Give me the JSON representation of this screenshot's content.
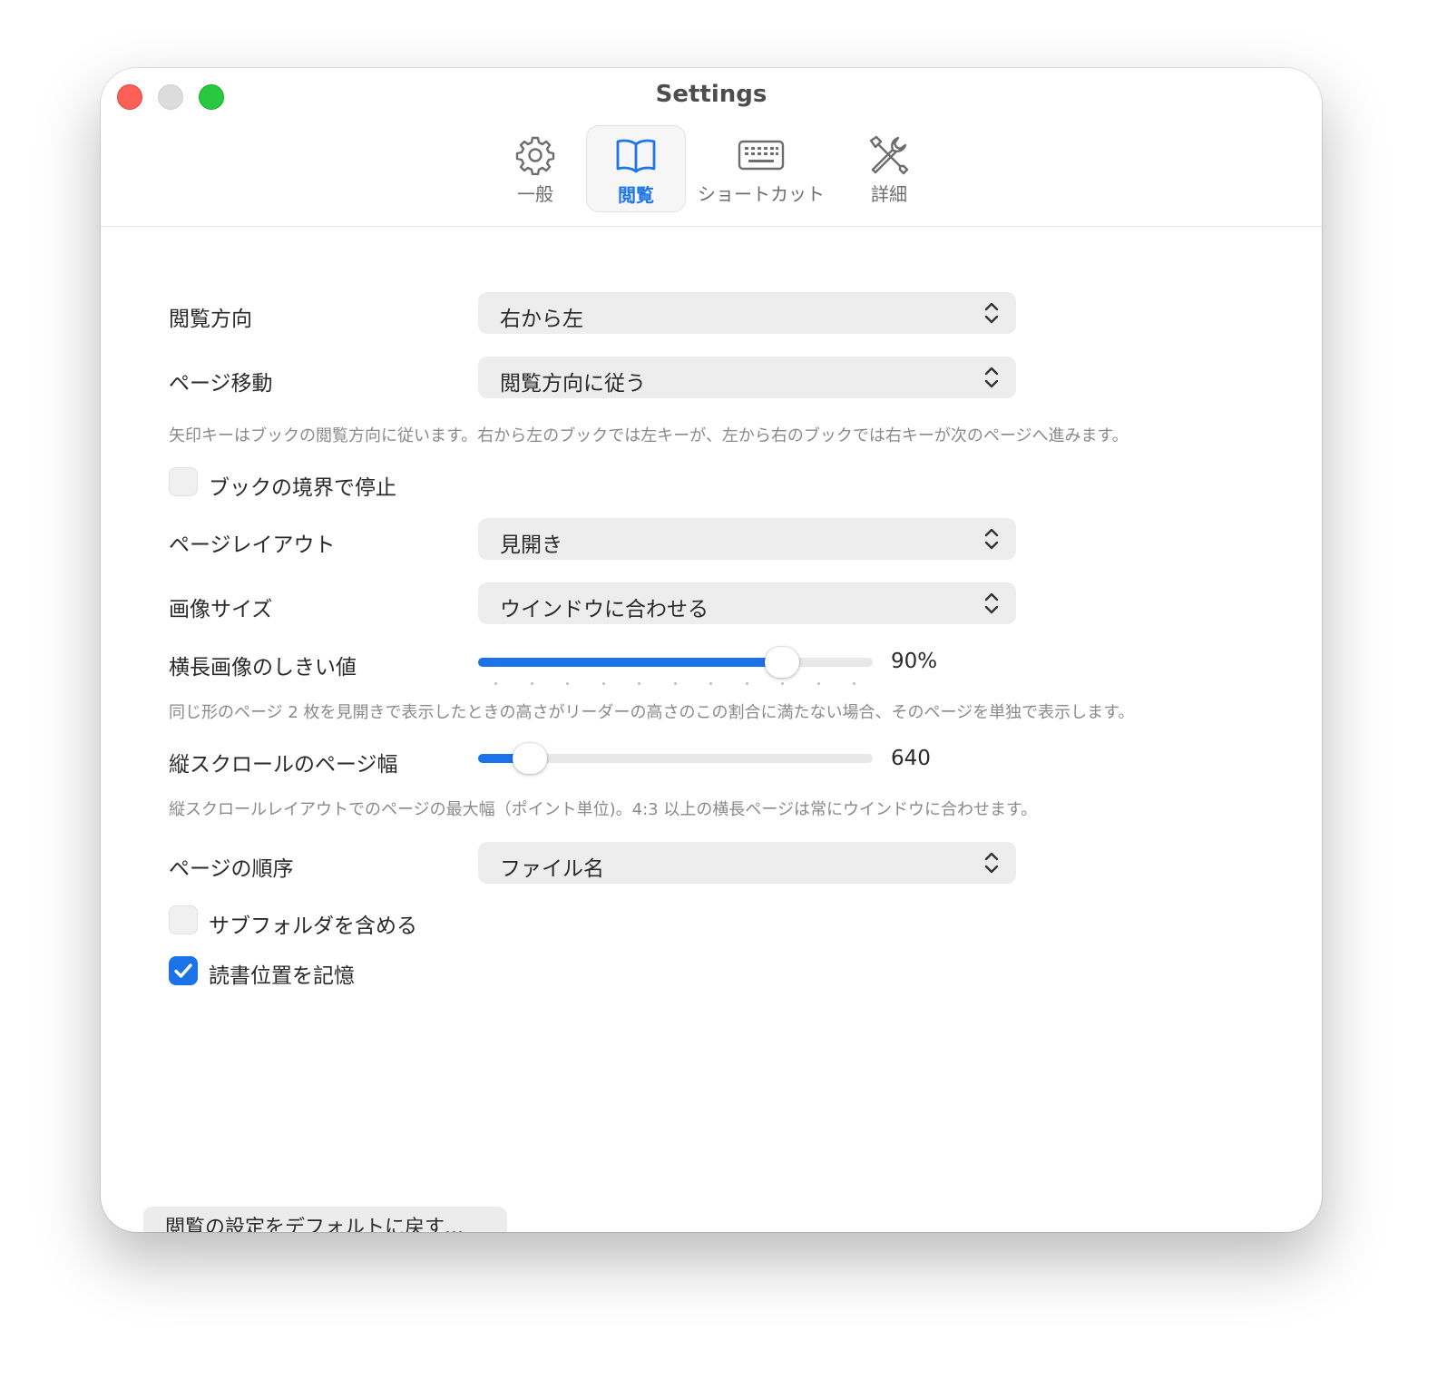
{
  "window": {
    "title": "Settings"
  },
  "tabs": [
    {
      "label": "一般",
      "icon": "gear-icon",
      "active": false
    },
    {
      "label": "閲覧",
      "icon": "book-icon",
      "active": true
    },
    {
      "label": "ショートカット",
      "icon": "keyboard-icon",
      "active": false
    },
    {
      "label": "詳細",
      "icon": "tools-icon",
      "active": false
    }
  ],
  "reading_direction": {
    "label": "閲覧方向",
    "value": "右から左"
  },
  "page_navigation": {
    "label": "ページ移動",
    "value": "閲覧方向に従う",
    "note": "矢印キーはブックの閲覧方向に従います。右から左のブックでは左キーが、左から右のブックでは右キーが次のページへ進みます。"
  },
  "stop_at_book_boundary": {
    "label": "ブックの境界で停止",
    "checked": false
  },
  "page_layout": {
    "label": "ページレイアウト",
    "value": "見開き"
  },
  "image_size": {
    "label": "画像サイズ",
    "value": "ウインドウに合わせる"
  },
  "landscape_threshold": {
    "label": "横長画像のしきい値",
    "value_text": "90%",
    "fraction": 0.77,
    "note": "同じ形のページ 2 枚を見開きで表示したときの高さがリーダーの高さのこの割合に満たない場合、そのページを単独で表示します。"
  },
  "vertical_scroll_width": {
    "label": "縦スクロールのページ幅",
    "value_text": "640",
    "fraction": 0.13,
    "note": "縦スクロールレイアウトでのページの最大幅（ポイント単位)。4:3 以上の横長ページは常にウインドウに合わせます。"
  },
  "page_order": {
    "label": "ページの順序",
    "value": "ファイル名"
  },
  "include_subfolders": {
    "label": "サブフォルダを含める",
    "checked": false
  },
  "remember_position": {
    "label": "読書位置を記憶",
    "checked": true
  },
  "reset_button": {
    "label": "閲覧の設定をデフォルトに戻す..."
  },
  "colors": {
    "accent": "#1a73e8",
    "close": "#fe5f57",
    "zoom": "#28c840"
  }
}
